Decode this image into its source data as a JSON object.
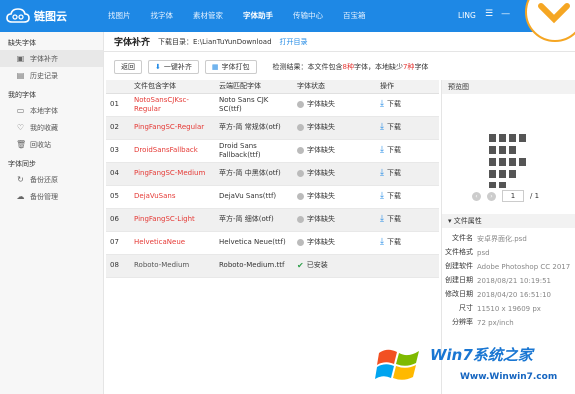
{
  "app": {
    "name": "链图云"
  },
  "nav": [
    "找图片",
    "找字体",
    "素材管家",
    "字体助手",
    "传输中心",
    "百宝箱"
  ],
  "user": {
    "name": "LING"
  },
  "sidebar": {
    "sections": [
      {
        "title": "缺失字体",
        "items": [
          "字体补齐",
          "历史记录"
        ]
      },
      {
        "title": "我的字体",
        "items": [
          "本地字体",
          "我的收藏",
          "回收站"
        ]
      },
      {
        "title": "字体同步",
        "items": [
          "备份还原",
          "备份管理"
        ]
      }
    ]
  },
  "header": {
    "title": "字体补齐",
    "dir_label": "下载目录：E:\\LianTuYunDownload",
    "open_link": "打开目录"
  },
  "toolbar": {
    "back": "返回",
    "one_click": "一键补齐",
    "pack": "字体打包",
    "result_prefix": "检测结果：本文件包含",
    "total": "8种",
    "result_mid": "字体，本地缺少",
    "missing": "7种",
    "result_suffix": "字体"
  },
  "table": {
    "headers": [
      "",
      "文件包含字体",
      "云端匹配字体",
      "字体状态",
      "操作"
    ],
    "rows": [
      {
        "no": "01",
        "file_font": "NotoSansCJKsc-Regular",
        "cloud_font": "Noto Sans CJK SC(ttf)",
        "status": "字体缺失",
        "action": "下载",
        "ok": false
      },
      {
        "no": "02",
        "file_font": "PingFangSC-Regular",
        "cloud_font": "苹方-简 常规体(otf)",
        "status": "字体缺失",
        "action": "下载",
        "ok": false
      },
      {
        "no": "03",
        "file_font": "DroidSansFallback",
        "cloud_font": "Droid Sans Fallback(ttf)",
        "status": "字体缺失",
        "action": "下载",
        "ok": false
      },
      {
        "no": "04",
        "file_font": "PingFangSC-Medium",
        "cloud_font": "苹方-简 中黑体(otf)",
        "status": "字体缺失",
        "action": "下载",
        "ok": false
      },
      {
        "no": "05",
        "file_font": "DejaVuSans",
        "cloud_font": "DejaVu Sans(ttf)",
        "status": "字体缺失",
        "action": "下载",
        "ok": false
      },
      {
        "no": "06",
        "file_font": "PingFangSC-Light",
        "cloud_font": "苹方-简 细体(otf)",
        "status": "字体缺失",
        "action": "下载",
        "ok": false
      },
      {
        "no": "07",
        "file_font": "HelveticaNeue",
        "cloud_font": "Helvetica Neue(ttf)",
        "status": "字体缺失",
        "action": "下载",
        "ok": false
      },
      {
        "no": "08",
        "file_font": "Roboto-Medium",
        "cloud_font": "Roboto-Medium.ttf",
        "status": "已安装",
        "action": "",
        "ok": true
      }
    ]
  },
  "preview": {
    "title": "预览图",
    "page": "1",
    "total": "/ 1"
  },
  "attributes": {
    "title": "文件属性",
    "items": [
      {
        "k": "文件名",
        "v": "安卓界面化.psd"
      },
      {
        "k": "文件格式",
        "v": "psd"
      },
      {
        "k": "创建软件",
        "v": "Adobe Photoshop CC 2017"
      },
      {
        "k": "创建日期",
        "v": "2018/08/21 10:19:51"
      },
      {
        "k": "修改日期",
        "v": "2018/04/20 16:51:10"
      },
      {
        "k": "尺寸",
        "v": "11510 x 19609 px"
      },
      {
        "k": "分辨率",
        "v": "72 px/inch"
      }
    ]
  },
  "watermark": {
    "text": "Win7系统之家",
    "url": "Www.Winwin7.com"
  },
  "colors": {
    "brand": "#1e88e5",
    "missing": "#e53935",
    "ok": "#2e9e4a"
  }
}
